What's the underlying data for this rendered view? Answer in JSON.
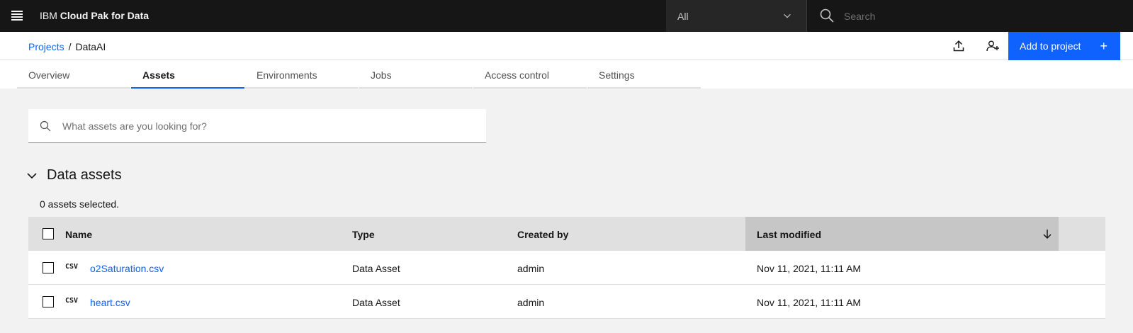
{
  "app": {
    "brand_prefix": "IBM",
    "brand_name": "Cloud Pak for Data"
  },
  "topnav": {
    "scope_value": "All",
    "search_placeholder": "Search"
  },
  "breadcrumb": {
    "parent": "Projects",
    "separator": "/",
    "current": "DataAI"
  },
  "header": {
    "add_button_label": "Add to project",
    "add_icon": "+"
  },
  "tabs": [
    {
      "label": "Overview",
      "active": false
    },
    {
      "label": "Assets",
      "active": true
    },
    {
      "label": "Environments",
      "active": false
    },
    {
      "label": "Jobs",
      "active": false
    },
    {
      "label": "Access control",
      "active": false
    },
    {
      "label": "Settings",
      "active": false
    }
  ],
  "asset_search": {
    "placeholder": "What assets are you looking for?"
  },
  "section": {
    "title": "Data assets",
    "selected_text": "0 assets selected."
  },
  "table": {
    "columns": {
      "name": "Name",
      "type": "Type",
      "created_by": "Created by",
      "last_modified": "Last modified"
    },
    "rows": [
      {
        "badge": "CSV",
        "name": "o2Saturation.csv",
        "type": "Data Asset",
        "created_by": "admin",
        "last_modified": "Nov 11, 2021, 11:11 AM"
      },
      {
        "badge": "CSV",
        "name": "heart.csv",
        "type": "Data Asset",
        "created_by": "admin",
        "last_modified": "Nov 11, 2021, 11:11 AM"
      }
    ]
  },
  "colors": {
    "accent": "#0f62fe",
    "topbar": "#161616",
    "background": "#f2f2f2"
  }
}
